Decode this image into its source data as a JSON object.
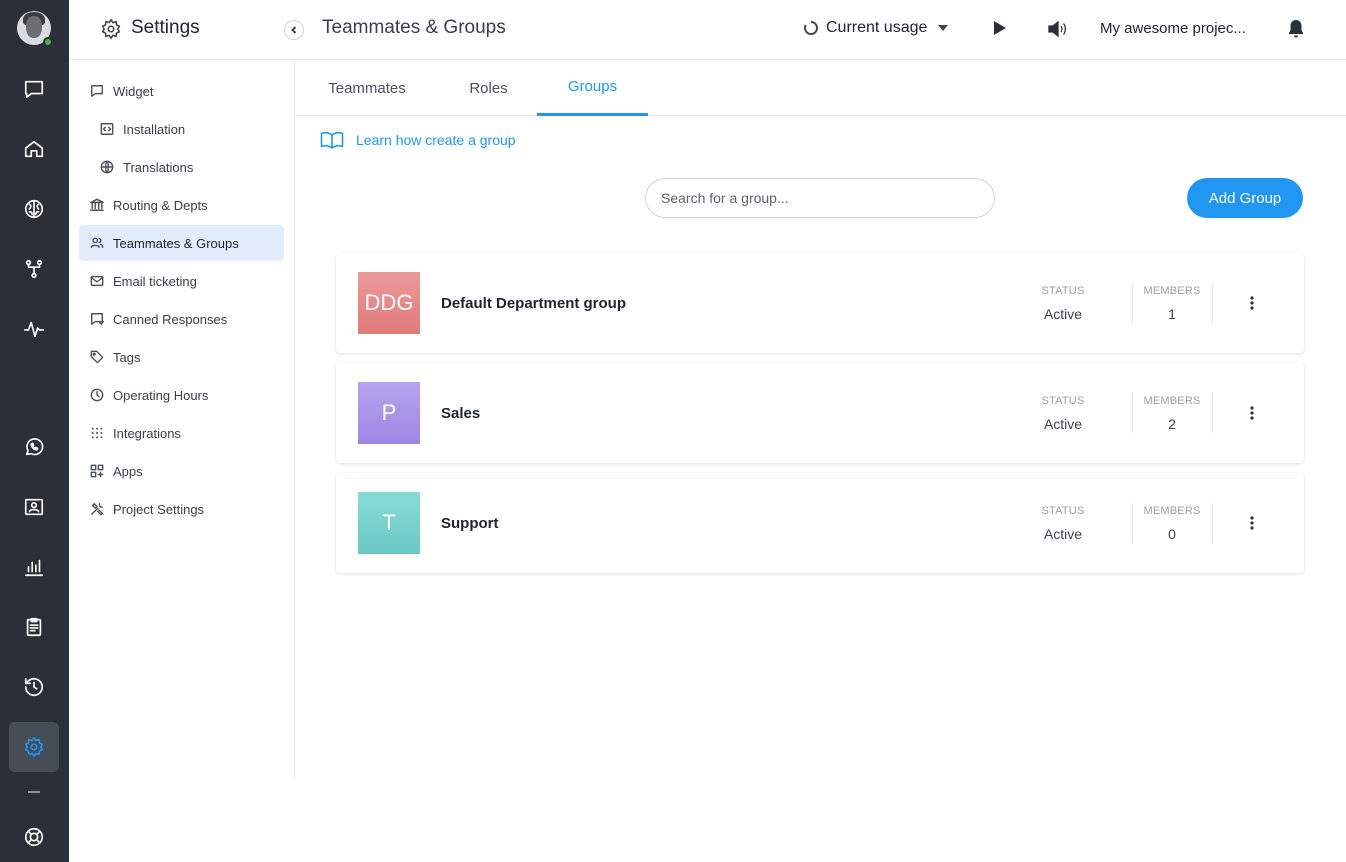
{
  "header": {
    "title": "Settings",
    "page_title": "Teammates & Groups",
    "usage_label": "Current usage",
    "project_name": "My awesome projec..."
  },
  "sidebar": {
    "items": [
      {
        "label": "Widget",
        "icon": "message-square-icon"
      },
      {
        "label": "Installation",
        "icon": "code-icon"
      },
      {
        "label": "Translations",
        "icon": "globe-icon"
      },
      {
        "label": "Routing & Depts",
        "icon": "bank-icon"
      },
      {
        "label": "Teammates & Groups",
        "icon": "users-icon"
      },
      {
        "label": "Email ticketing",
        "icon": "mail-icon"
      },
      {
        "label": "Canned Responses",
        "icon": "canned-message-icon"
      },
      {
        "label": "Tags",
        "icon": "tag-icon"
      },
      {
        "label": "Operating Hours",
        "icon": "clock-icon"
      },
      {
        "label": "Integrations",
        "icon": "grid-dots-icon"
      },
      {
        "label": "Apps",
        "icon": "apps-icon"
      },
      {
        "label": "Project Settings",
        "icon": "tools-icon"
      }
    ]
  },
  "tabs": [
    {
      "label": "Teammates"
    },
    {
      "label": "Roles"
    },
    {
      "label": "Groups"
    }
  ],
  "main": {
    "learn_link": "Learn how create a group",
    "search_placeholder": "Search for a group...",
    "add_button": "Add Group"
  },
  "groups": [
    {
      "initials": "DDG",
      "name": "Default Department group",
      "status_label": "STATUS",
      "status": "Active",
      "members_label": "MEMBERS",
      "members": "1",
      "color_top": "#ec9a9a",
      "color_bottom": "#e07a7b"
    },
    {
      "initials": "P",
      "name": "Sales",
      "status_label": "STATUS",
      "status": "Active",
      "members_label": "MEMBERS",
      "members": "2",
      "color_top": "#b6a4ee",
      "color_bottom": "#9d86e4"
    },
    {
      "initials": "T",
      "name": "Support",
      "status_label": "STATUS",
      "status": "Active",
      "members_label": "MEMBERS",
      "members": "0",
      "color_top": "#86dcd6",
      "color_bottom": "#6cc8c4"
    }
  ],
  "colors": {
    "accent": "#2196f3",
    "rail_bg": "#2b3038",
    "active_item_bg": "#e3ecfa",
    "online": "#4caf50"
  }
}
